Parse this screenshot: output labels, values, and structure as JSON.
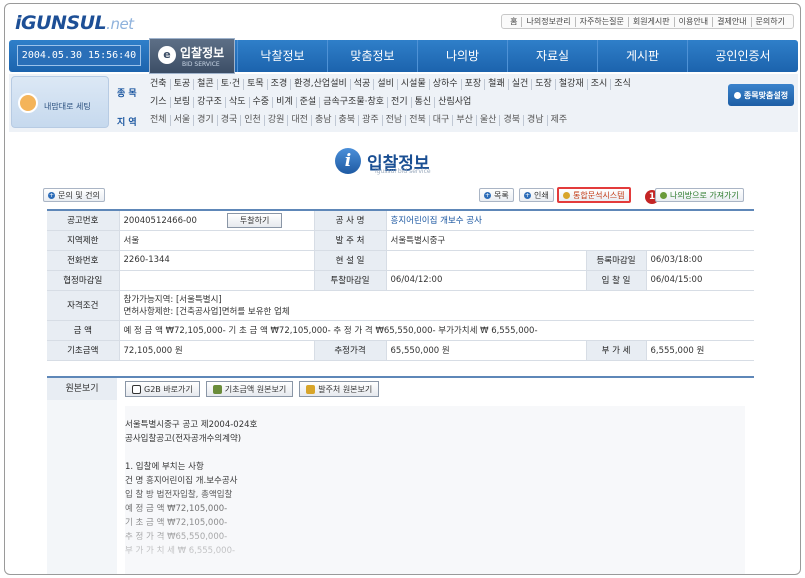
{
  "header": {
    "logo_main": "iGUNSUL",
    "logo_suffix": ".net",
    "top_links": [
      "홈",
      "나의정보관리",
      "자주하는질문",
      "회원게시판",
      "이용안내",
      "결제안내",
      "문의하기"
    ]
  },
  "nav": {
    "clock": "2004.05.30 15:56:40",
    "active_tab_label": "입찰정보",
    "active_tab_sub": "BID SERVICE",
    "items": [
      "낙찰정보",
      "맞춤정보",
      "나의방",
      "자료실",
      "게시판",
      "공인인증서"
    ]
  },
  "subnav": {
    "my_card_label": "내맘대로 세팅",
    "category_label": "종 목",
    "categories_row1": [
      "건축",
      "토공",
      "철콘",
      "토·건",
      "토목",
      "조경",
      "환경,산업설비",
      "석공",
      "설비",
      "시설물",
      "상하수",
      "포장",
      "철쾌",
      "실건",
      "도장",
      "철강재",
      "조시",
      "조식"
    ],
    "categories_row2": [
      "기스",
      "보링",
      "강구조",
      "삭도",
      "수중",
      "비계",
      "준설",
      "금속구조물·창호",
      "전기",
      "통신",
      "산림사업"
    ],
    "region_label": "지 역",
    "regions": [
      "전체",
      "서울",
      "경기",
      "경국",
      "인천",
      "강원",
      "대전",
      "충남",
      "충북",
      "광주",
      "전남",
      "전북",
      "대구",
      "부산",
      "울산",
      "경북",
      "경남",
      "제주"
    ],
    "jongmok_button": "종목맞춤설정"
  },
  "page": {
    "title": "입찰정보",
    "subtitle": "igussul bid service"
  },
  "actions": {
    "inquiry": "문의 및 건의",
    "list": "목록",
    "print": "인쇄",
    "integrated": "통합문석시스템",
    "badge": "1",
    "mine": "나의방으로 가져가기"
  },
  "detail": {
    "notice_no_label": "공고번호",
    "notice_no": "20040512466-00",
    "bid_button": "투찰하기",
    "project_label": "공 사 명",
    "project": "흥지어린이집 개보수 공사",
    "region_limit_label": "지역제한",
    "region_limit": "서울",
    "orderer_label": "발 주 처",
    "orderer": "서울특별시중구",
    "phone_label": "전화번호",
    "phone": "2260-1344",
    "briefing_label": "현 설 일",
    "briefing": "",
    "reg_deadline_label": "등록마감일",
    "reg_deadline": "06/03/18:00",
    "joint_deadline_label": "협정마감일",
    "joint_deadline": "",
    "bid_deadline_label": "투찰마감일",
    "bid_deadline": "06/04/12:00",
    "open_date_label": "입 찰 일",
    "open_date": "06/04/15:00",
    "qualification_label": "자격조건",
    "qualification_1": "참가가능지역: [서울특별시]",
    "qualification_2": "면허사항제한: [건축공사업]면허를 보유한 업체",
    "amount_label": "금 액",
    "amount": "예 정 금 액 ₩72,105,000- 기 초 금 액 ₩72,105,000- 추 정 가 격 ₩65,550,000- 부가가치세 ₩ 6,555,000-",
    "base_amount_label": "기초금액",
    "base_amount": "72,105,000 원",
    "est_price_label": "추정가격",
    "est_price": "65,550,000 원",
    "vat_label": "부 가 세",
    "vat": "6,555,000 원"
  },
  "original": {
    "label": "원본보기",
    "btn_g2b": "G2B 바로가기",
    "btn_base": "기초금액 원본보기",
    "btn_orderer": "발주처 원본보기",
    "lines": [
      "서울특별시중구 공고 제2004-024호",
      "공사입찰공고(전자공개수의계약)",
      "",
      "1. 입찰에 부치는 사항",
      "건 명 흥지어린이집 개.보수공사",
      "입 찰 방 법전자입찰, 총액입찰",
      "예 정 금 액 ₩72,105,000-",
      "기 초 금 액 ₩72,105,000-",
      "추 정 가 격 ₩65,550,000-",
      "부 가 가 치 세 ₩ 6,555,000-"
    ]
  },
  "colors": {
    "nav_blue": "#1c63ad",
    "accent_red": "#e33b3b",
    "label_blue": "#1a56a0"
  }
}
